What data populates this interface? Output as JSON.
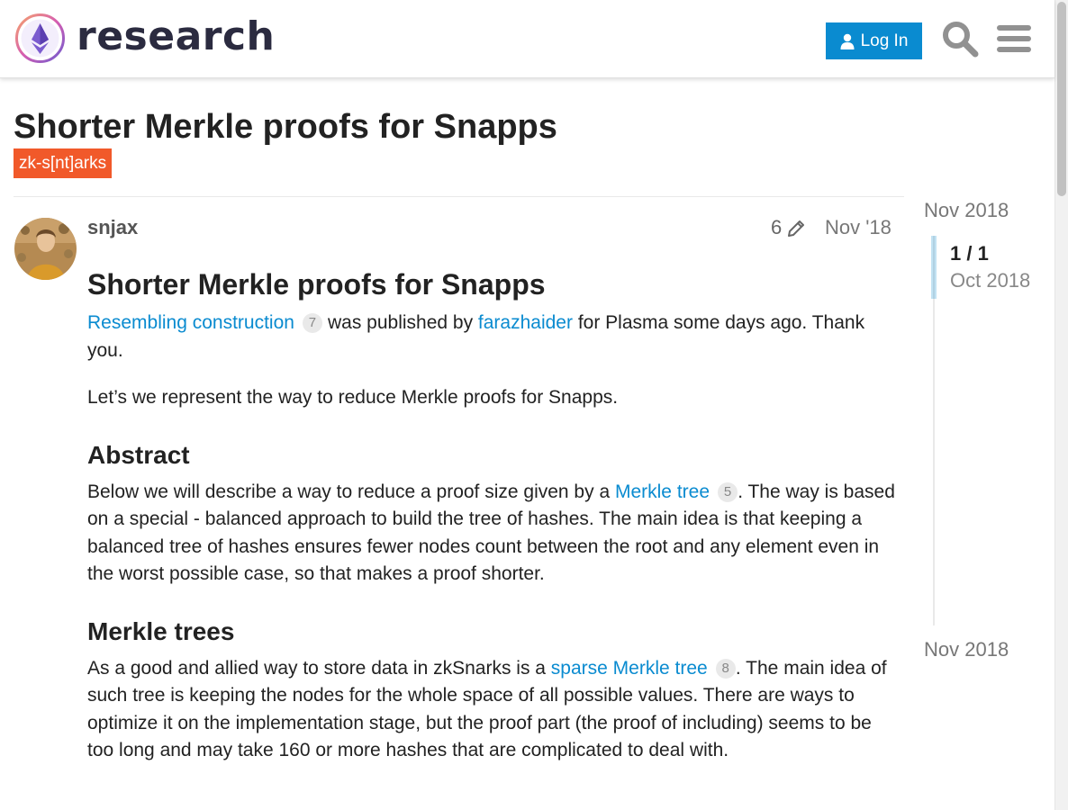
{
  "header": {
    "logo_text": "research",
    "login_label": "Log In"
  },
  "topic": {
    "title": "Shorter Merkle proofs for Snapps",
    "category": "zk-s[nt]arks",
    "category_color": "#f1592a"
  },
  "post": {
    "username": "snjax",
    "edit_count": "6",
    "date": "Nov '18",
    "heading": "Shorter Merkle proofs for Snapps",
    "p1": {
      "link1": "Resembling construction",
      "link1_clicks": "7",
      "text1": " was published by ",
      "link2": "farazhaider",
      "text2": " for Plasma some days ago. Thank you."
    },
    "p2": "Let’s we represent the way to reduce Merkle proofs for Snapps.",
    "section1_title": "Abstract",
    "p3": {
      "text1": "Below we will describe a way to reduce a proof size given by a ",
      "link": "Merkle tree",
      "link_clicks": "5",
      "text2": ". The way is based on a special - balanced approach to build the tree of hashes. The main idea is that keeping a balanced tree of hashes ensures fewer nodes count between the root and any element even in the worst possible case, so that makes a proof shorter."
    },
    "section2_title": "Merkle trees",
    "p4": {
      "text1": "As a good and allied way to store data in zkSnarks is a ",
      "link": "sparse Merkle tree",
      "link_clicks": "8",
      "text2": ". The main idea of such tree is keeping the nodes for the whole space of all possible values. There are ways to optimize it on the implementation stage, but the proof part (the proof of including) seems to be too long and may take 160 or more hashes that are complicated to deal with."
    }
  },
  "timeline": {
    "top_date": "Nov 2018",
    "counter": "1 / 1",
    "handle_date": "Oct 2018",
    "bottom_date": "Nov 2018"
  },
  "colors": {
    "accent": "#0a8bd0",
    "text": "#222222"
  },
  "icons": [
    "user-icon",
    "search-icon",
    "menu-icon",
    "pencil-icon"
  ]
}
